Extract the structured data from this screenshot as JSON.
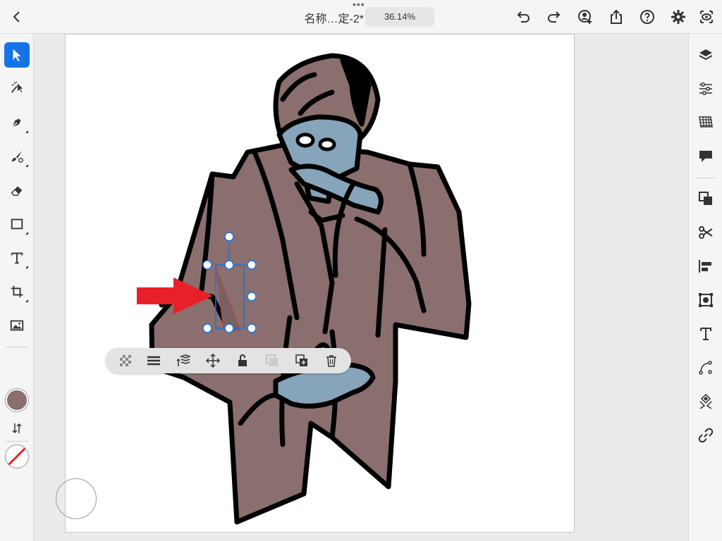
{
  "header": {
    "document_title": "名称…定-2*",
    "zoom_level": "36.14%"
  },
  "colors": {
    "accent": "#1473e6",
    "fill_color": "#8a6f6e",
    "suit": "#8a6f6e",
    "skin": "#86a5bb",
    "arrow": "#e8202a",
    "selection": "#1473e6"
  },
  "left_toolbar": {
    "tools": [
      "selection-tool",
      "direct-selection-tool",
      "pen-tool",
      "brush-tool",
      "eraser-tool",
      "rectangle-tool",
      "type-tool",
      "crop-tool",
      "image-tool"
    ],
    "active_tool": "selection-tool"
  },
  "right_toolbar": {
    "items": [
      "layers-icon",
      "properties-icon",
      "swatches-icon",
      "comments-icon",
      "arrange-icon",
      "scissors-icon",
      "align-icon",
      "transform-icon",
      "type-panel-icon",
      "path-icon",
      "repeat-icon",
      "link-icon"
    ]
  },
  "context_toolbar": {
    "items": [
      "opacity-icon",
      "stroke-weight-icon",
      "arrange-layers-icon",
      "move-icon",
      "lock-icon",
      "duplicate-disabled-icon",
      "duplicate-icon",
      "trash-icon"
    ]
  }
}
